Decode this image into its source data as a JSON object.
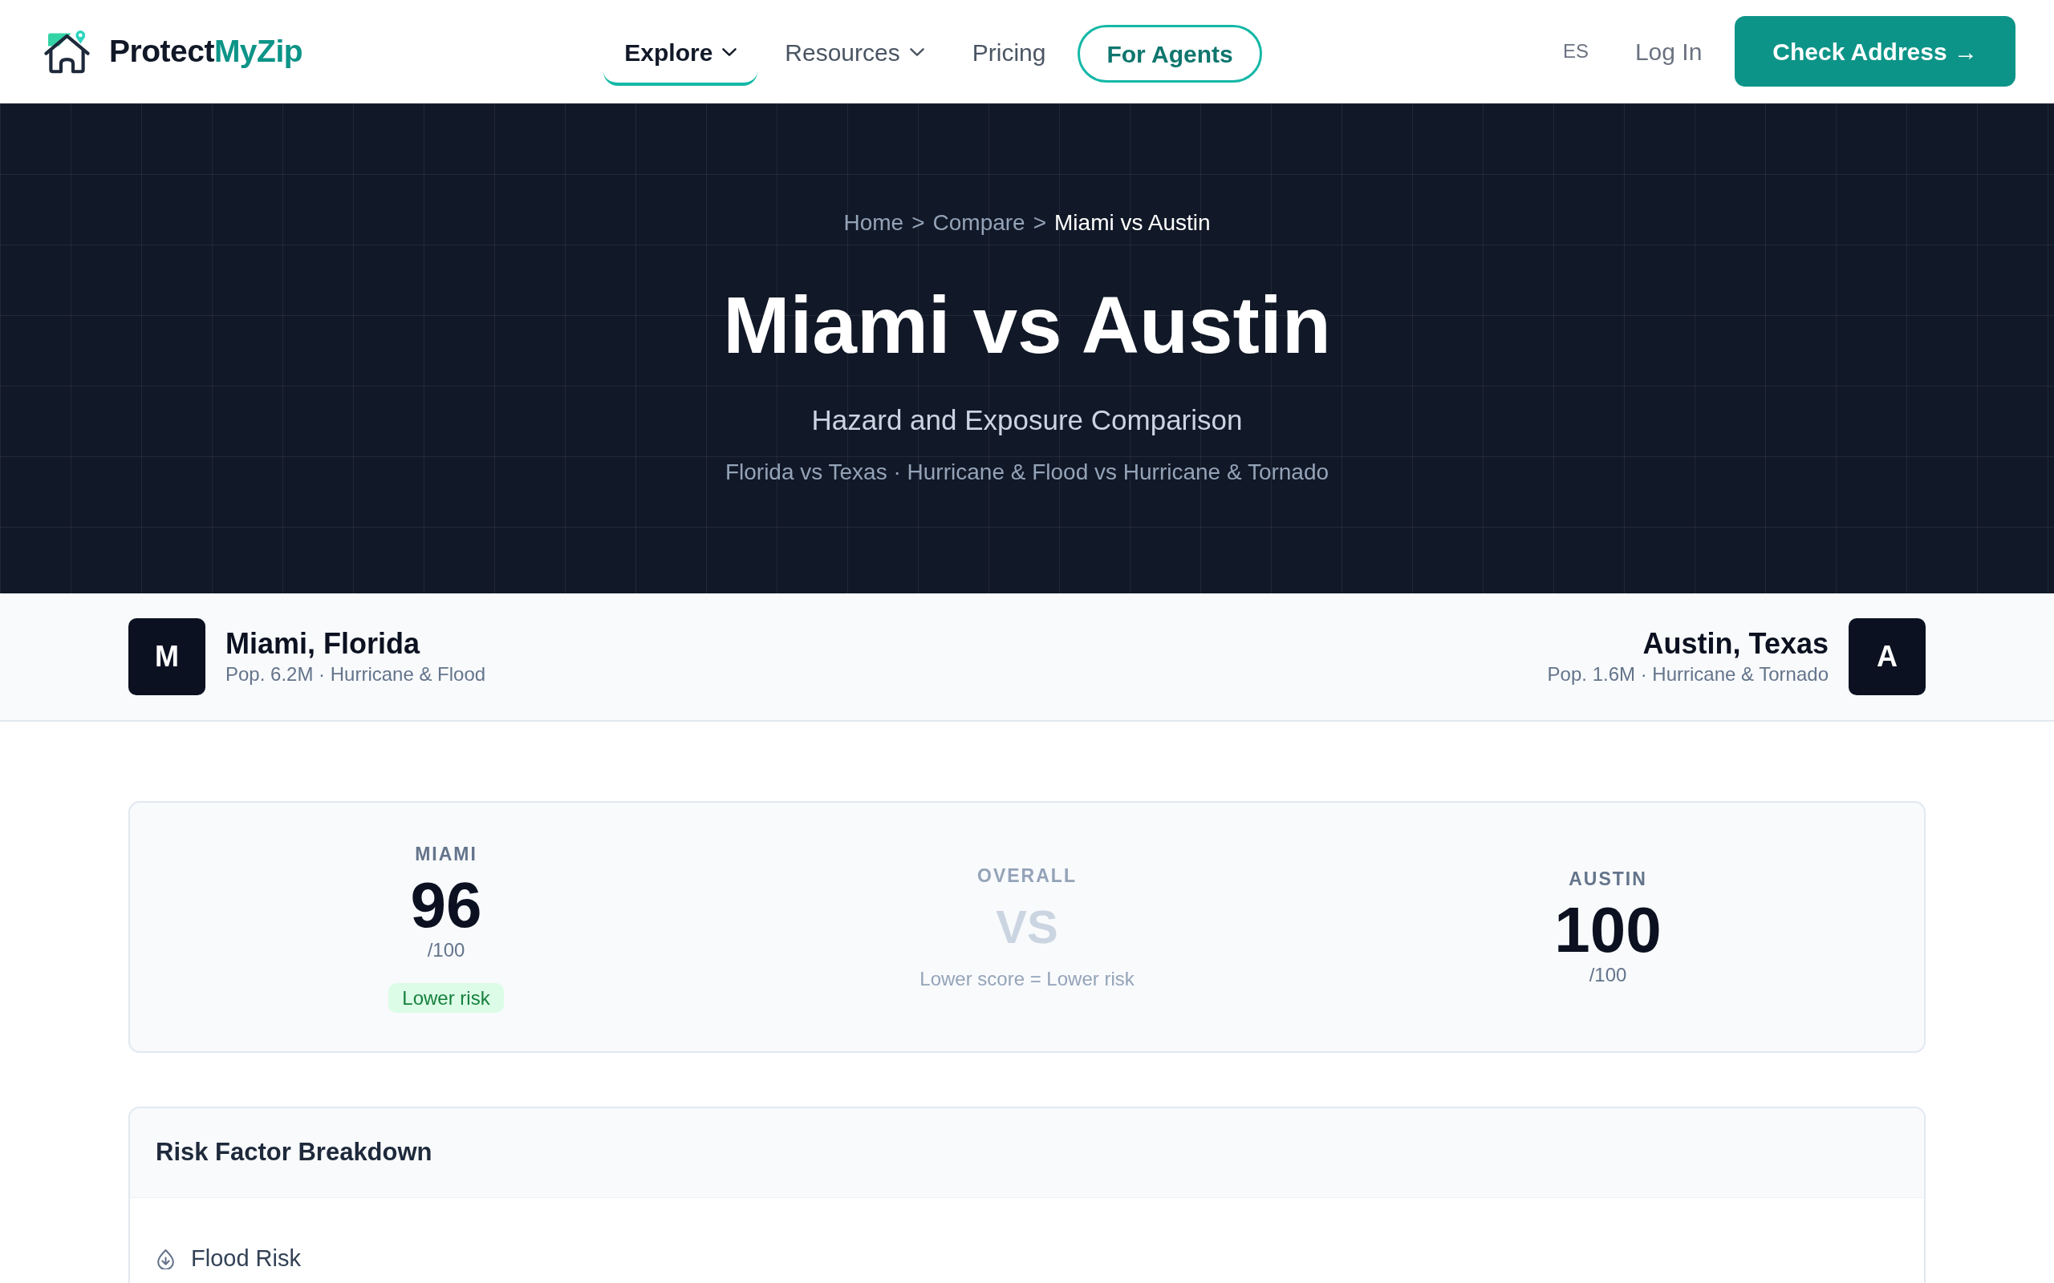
{
  "header": {
    "logo": {
      "text": "Protect",
      "accent": "MyZip"
    },
    "nav": [
      {
        "label": "Explore",
        "kind": "dropdown",
        "selected": true
      },
      {
        "label": "Resources",
        "kind": "dropdown",
        "selected": false
      },
      {
        "label": "Pricing",
        "kind": "link",
        "selected": false
      },
      {
        "label": "For Agents",
        "kind": "outlined",
        "selected": false
      }
    ],
    "language": "ES",
    "login": "Log In",
    "cta": "Check Address →"
  },
  "hero": {
    "breadcrumbs": [
      {
        "kind": "link",
        "label": "Home"
      },
      {
        "kind": "separator",
        "label": ">"
      },
      {
        "kind": "link",
        "label": "Compare"
      },
      {
        "kind": "separator",
        "label": ">"
      },
      {
        "kind": "current",
        "label": "Miami vs Austin"
      }
    ],
    "title": "Miami vs Austin",
    "subtitle": "Hazard and Exposure Comparison",
    "description": "Florida vs Texas · Hurricane & Flood vs Hurricane & Tornado"
  },
  "cities": [
    {
      "initial": "M",
      "name": "Miami, Florida",
      "details": "Pop. 6.2M · Hurricane & Flood"
    },
    {
      "initial": "A",
      "name": "Austin, Texas",
      "details": "Pop. 1.6M · Hurricane & Tornado"
    }
  ],
  "score_card": {
    "columns": [
      {
        "kind": "city",
        "label": "MIAMI",
        "score": "96",
        "scale": "/100",
        "badge": "Lower risk"
      },
      {
        "kind": "overall",
        "label": "OVERALL",
        "vs": "VS",
        "note": "Lower score = Lower risk"
      },
      {
        "kind": "city",
        "label": "AUSTIN",
        "score": "100",
        "scale": "/100"
      }
    ]
  },
  "breakdown": {
    "title": "Risk Factor Breakdown",
    "factors": [
      {
        "kind": "flood",
        "label": "Flood Risk"
      }
    ]
  }
}
